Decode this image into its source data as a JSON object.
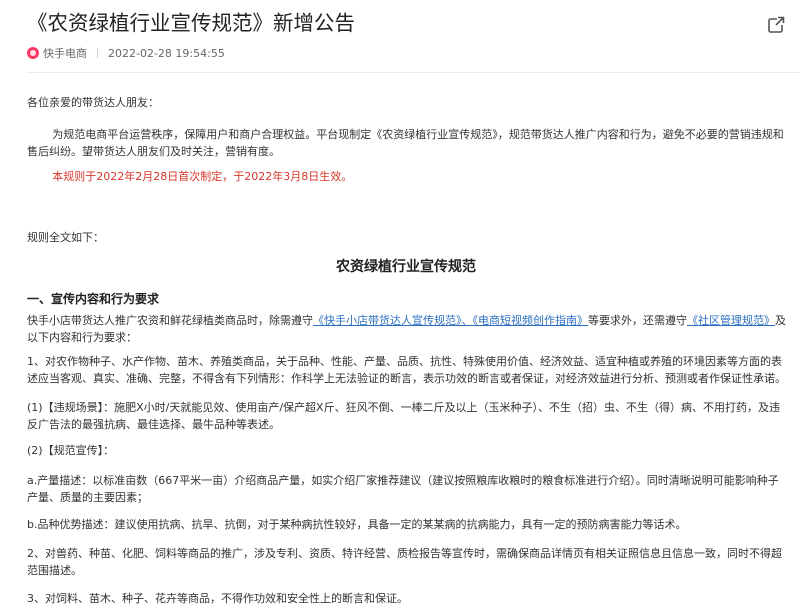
{
  "header": {
    "title": "《农资绿植行业宣传规范》新增公告",
    "share_icon": "share-external-icon",
    "source": "快手电商",
    "source_logo": "kuaishou-logo",
    "datetime": "2022-02-28 19:54:55"
  },
  "content": {
    "greeting": "各位亲爱的带货达人朋友：",
    "intro": "为规范电商平台运营秩序，保障用户和商户合理权益。平台现制定《农资绿植行业宣传规范》，规范带货达人推广内容和行为，避免不必要的营销违规和售后纠纷。望带货达人朋友们及时关注，营销有度。",
    "effective_note": "本规则于2022年2月28日首次制定，于2022年3月8日生效。",
    "full_text_label": "规则全文如下：",
    "doc_title": "农资绿植行业宣传规范",
    "section1_title": "一、宣传内容和行为要求",
    "section1_intro_a": "快手小店带货达人推广农资和鲜花绿植类商品时，除需遵守",
    "link1": "《快手小店带货达人宣传规范》",
    "sep1": "、",
    "link2": "《电商短视频创作指南》",
    "section1_intro_b": "等要求外，还需遵守",
    "link3": "《社区管理规范》",
    "section1_intro_c": "及以下内容和行为要求：",
    "item1": "1、对农作物种子、水产作物、苗木、养殖类商品，关于品种、性能、产量、品质、抗性、特殊使用价值、经济效益、适宜种植或养殖的环境因素等方面的表述应当客观、真实、准确、完整，不得含有下列情形：作科学上无法验证的断言，表示功效的断言或者保证，对经济效益进行分析、预测或者作保证性承诺。",
    "item1_violation": "(1)【违规场景】：施肥X小时/天就能见效、使用亩产/保产超X斤、狂风不倒、一棒二斤及以上（玉米种子）、不生（招）虫、不生（得）病、不用打药，及违反广告法的最强抗病、最佳选择、最牛品种等表述。",
    "item1_promo": "(2)【规范宣传】：",
    "item1_a": "a.产量描述：以标准亩数（667平米一亩）介绍商品产量，如实介绍厂家推荐建议（建议按照粮库收粮时的粮食标准进行介绍）。同时清晰说明可能影响种子产量、质量的主要因素；",
    "item1_b": "b.品种优势描述：建议使用抗病、抗旱、抗倒，对于某种病抗性较好，具备一定的某某病的抗病能力，具有一定的预防病害能力等话术。",
    "item2": "2、对兽药、种苗、化肥、饲料等商品的推广，涉及专利、资质、特许经营、质检报告等宣传时，需确保商品详情页有相关证照信息且信息一致，同时不得超范围描述。",
    "item3": "3、对饲料、苗木、种子、花卉等商品，不得作功效和安全性上的断言和保证。"
  },
  "colors": {
    "accent_red": "#d9362b",
    "link_blue": "#2d6fc0",
    "logo_pink": "#fe3666"
  }
}
